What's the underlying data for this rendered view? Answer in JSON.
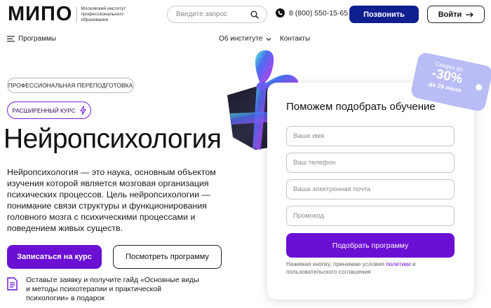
{
  "header": {
    "logo_word": "МИПО",
    "logo_subtitle": "Московский институт профессионального образования",
    "search_placeholder": "Введите запрос",
    "phone": "8 (800) 550-15-65",
    "call_label": "Позвонить",
    "login_label": "Войти"
  },
  "nav": {
    "programs": "Программы",
    "about": "Об институте",
    "contacts": "Контакты"
  },
  "hero": {
    "tag_professional": "ПРОФЕССИОНАЛЬНАЯ ПЕРЕПОДГОТОВКА",
    "tag_extended": "РАСШИРЕННЫЙ КУРС",
    "title": "Нейропсихология",
    "description": "Нейропсихология — это наука, основным объектом изучения которой является мозговая организация психических процессов. Цель нейропсихологии — понимание связи структуры и функционирования головного мозга с психическими процессами и поведением живых существ.",
    "enroll_label": "Записаться на курс",
    "view_program_label": "Посмотреть программу",
    "guide_text": "Оставьте заявку и получите гайд «Основные виды и методы психотерапии и практической психологии» в подарок"
  },
  "form": {
    "title": "Поможем подобрать обучение",
    "name_placeholder": "Ваше имя",
    "phone_placeholder": "Ваш телефон",
    "email_placeholder": "Ваша электронная почта",
    "promo_placeholder": "Промокод",
    "submit_label": "Подобрать программу",
    "consent_prefix": "Нажимая кнопку, принимаю условия ",
    "consent_link": "политики",
    "consent_suffix": " и пользовательского соглашения"
  },
  "badge": {
    "line1": "Скидка до",
    "percent": "-30%",
    "line3": "до 29 июля"
  },
  "colors": {
    "primary_purple": "#6a0fd3",
    "call_blue": "#0f1f8f",
    "badge_lavender": "#b9bdf5"
  },
  "icons": [
    "search-icon",
    "phone-icon",
    "menu-icon",
    "chevron-down-icon",
    "arrow-right-icon",
    "lightning-icon",
    "document-icon",
    "gift-decoration"
  ]
}
